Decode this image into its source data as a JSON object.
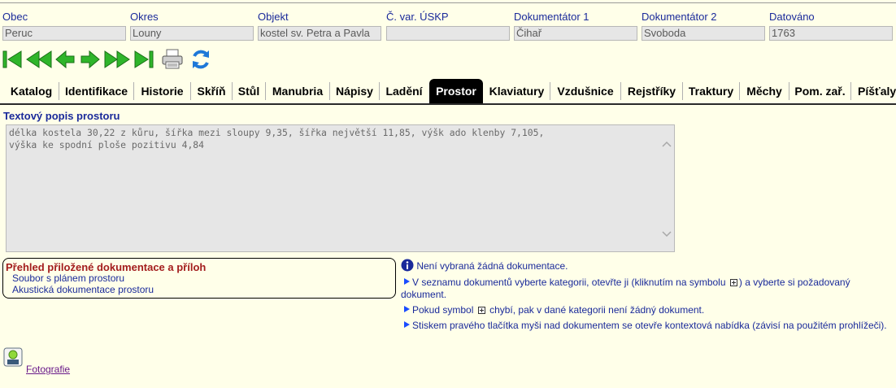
{
  "header": {
    "fields": [
      {
        "label": "Obec",
        "value": "Peruc"
      },
      {
        "label": "Okres",
        "value": "Louny"
      },
      {
        "label": "Objekt",
        "value": "kostel sv. Petra a Pavla"
      },
      {
        "label": "Č. var. ÚSKP",
        "value": ""
      },
      {
        "label": "Dokumentátor 1",
        "value": "Čihař"
      },
      {
        "label": "Dokumentátor 2",
        "value": "Svoboda"
      },
      {
        "label": "Datováno",
        "value": "1763"
      }
    ]
  },
  "toolbar": {
    "buttons": [
      "first-icon",
      "fast-back-icon",
      "back-icon",
      "forward-icon",
      "fast-forward-icon",
      "last-icon",
      "print-icon",
      "refresh-icon"
    ]
  },
  "tabs": {
    "items": [
      "Katalog",
      "Identifikace",
      "Historie",
      "Skříň",
      "Stůl",
      "Manubria",
      "Nápisy",
      "Ladění",
      "Prostor",
      "Klaviatury",
      "Vzdušnice",
      "Rejstříky",
      "Traktury",
      "Měchy",
      "Pom. zař.",
      "Píšťaly"
    ],
    "active": "Prostor"
  },
  "main": {
    "section_title": "Textový popis prostoru",
    "description": "délka kostela 30,22 z kůru, šířka mezi sloupy 9,35, šířka největší 11,85, výšk ado klenby 7,105,\nvýška ke spodní ploše pozitivu 4,84"
  },
  "docs": {
    "title": "Přehled přiložené dokumentace a příloh",
    "items": [
      "Soubor s plánem prostoru",
      "Akustická dokumentace prostoru"
    ]
  },
  "info": {
    "none_selected": "Není vybraná žádná dokumentace.",
    "hint1_a": "V seznamu dokumentů vyberte kategorii, otevřte ji (kliknutím na symbolu",
    "hint1_b": ") a vyberte si požadovaný dokument.",
    "hint2_a": "Pokud symbol",
    "hint2_b": "chybí, pak v dané kategorii není žádný dokument.",
    "hint3": "Stiskem pravého tlačítka myši nad dokumentem se otevře kontextová nabídka (závisí na použitém prohlížeči)."
  },
  "photo": {
    "label": "Fotografie"
  },
  "colors": {
    "background": "#ffffe9",
    "label_blue": "#1a2a9a",
    "accent_red": "#a31d1d",
    "nav_green": "#2fb52a",
    "active_tab": "#000000"
  }
}
